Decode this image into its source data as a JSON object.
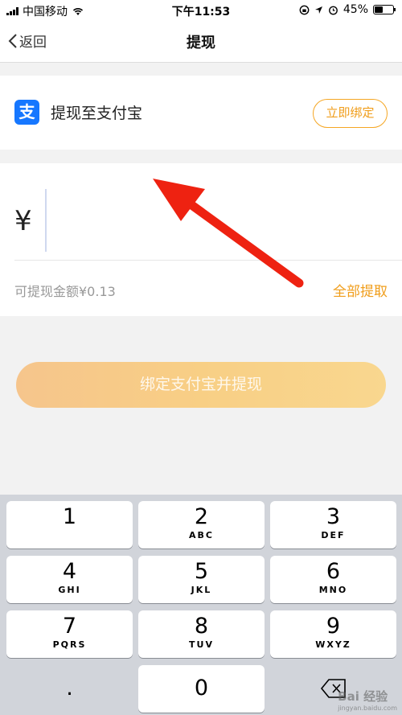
{
  "status_bar": {
    "carrier": "中国移动",
    "time": "下午11:53",
    "battery": "45%",
    "battery_level": 0.45
  },
  "nav": {
    "back_label": "返回",
    "title": "提现"
  },
  "alipay": {
    "icon_char": "支",
    "label": "提现至支付宝",
    "bind_button": "立即绑定"
  },
  "amount": {
    "currency_symbol": "¥",
    "available_text": "可提现金额¥0.13",
    "withdraw_all": "全部提取"
  },
  "main_button": "绑定支付宝并提现",
  "keypad": {
    "keys": [
      {
        "num": "1",
        "letters": ""
      },
      {
        "num": "2",
        "letters": "ABC"
      },
      {
        "num": "3",
        "letters": "DEF"
      },
      {
        "num": "4",
        "letters": "GHI"
      },
      {
        "num": "5",
        "letters": "JKL"
      },
      {
        "num": "6",
        "letters": "MNO"
      },
      {
        "num": "7",
        "letters": "PQRS"
      },
      {
        "num": "8",
        "letters": "TUV"
      },
      {
        "num": "9",
        "letters": "WXYZ"
      },
      {
        "num": ".",
        "letters": ""
      },
      {
        "num": "0",
        "letters": ""
      }
    ]
  },
  "watermark": {
    "brand": "Bai 经验",
    "site": "jingyan.baidu.com"
  },
  "colors": {
    "accent_orange": "#f09d1a",
    "alipay_blue": "#1677ff",
    "arrow_red": "#ee2211"
  },
  "icons": [
    "signal-icon",
    "wifi-icon",
    "lock-rotation-icon",
    "location-icon",
    "alarm-icon",
    "battery-icon",
    "back-chevron-icon",
    "alipay-icon",
    "backspace-icon",
    "annotation-arrow"
  ]
}
